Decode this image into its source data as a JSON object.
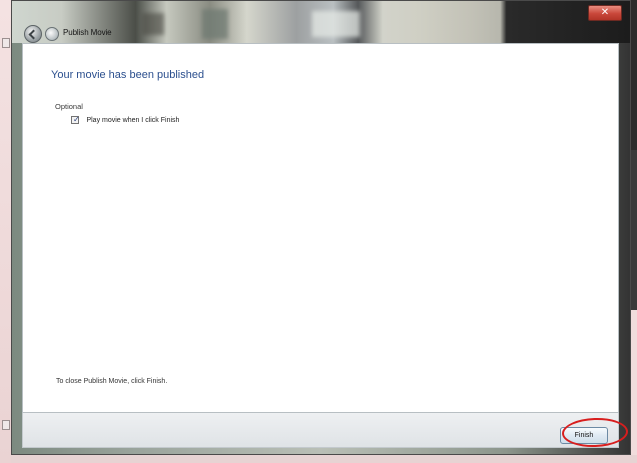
{
  "window": {
    "title": "Publish Movie",
    "close_glyph": "✕",
    "icons": {
      "back": "back-arrow-icon",
      "app": "movie-maker-icon",
      "close": "close-icon"
    }
  },
  "content": {
    "heading": "Your movie has been published",
    "optional_label": "Optional",
    "checkbox": {
      "label": "Play movie when I click Finish",
      "checked": true,
      "tick": "✓"
    },
    "footer_text": "To close Publish Movie, click Finish."
  },
  "buttons": {
    "finish_label": "Finish"
  },
  "colors": {
    "heading": "#2b4f8e",
    "highlight": "#d81e1e",
    "close_button": "#c9473a"
  }
}
